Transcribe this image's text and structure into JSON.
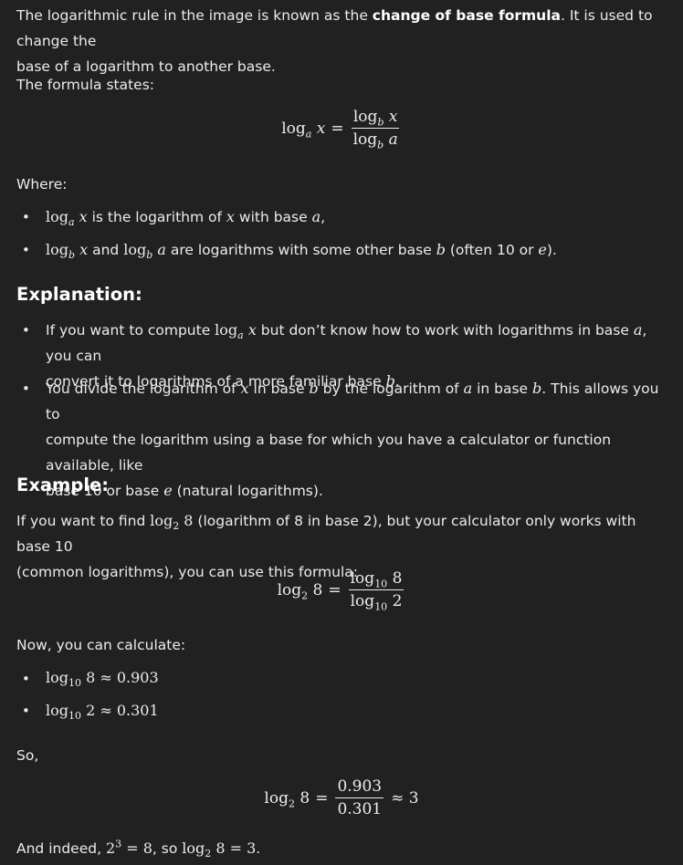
{
  "intro": {
    "pre": "The logarithmic rule in the image is known as the ",
    "bold": "change of base formula",
    "post1": ". It is used to change the",
    "post2": "base of a logarithm to another base."
  },
  "formula_states": "The formula states:",
  "where": "Where:",
  "where_items": {
    "b1_t1": "is the logarithm of",
    "b1_t2": "with base",
    "b2_t1": "and",
    "b2_t2": "are logarithms with some other base",
    "b2_t3": "(often 10 or"
  },
  "explanation": {
    "heading": "Explanation:",
    "i1_a": "If you want to compute",
    "i1_b": "but don’t know how to work with logarithms in base",
    "i1_c": ", you can",
    "i1_d": "convert it to logarithms of a more familiar base",
    "i2_a": "You divide the logarithm of",
    "i2_b": "in base",
    "i2_c": "by the logarithm of",
    "i2_d": "in base",
    "i2_e": ". This allows you to",
    "i2_f": "compute the logarithm using a base for which you have a calculator or function available, like",
    "i2_g": "base 10 or base",
    "i2_h": "(natural logarithms)."
  },
  "example": {
    "heading": "Example:",
    "p1_a": "If you want to find",
    "p1_b": "(logarithm of 8 in base 2), but your calculator only works with base 10",
    "p1_c": "(common logarithms), you can use this formula:",
    "now": "Now, you can calculate:",
    "so": "So,",
    "indeed_a": "And indeed,",
    "indeed_b": ", so"
  }
}
